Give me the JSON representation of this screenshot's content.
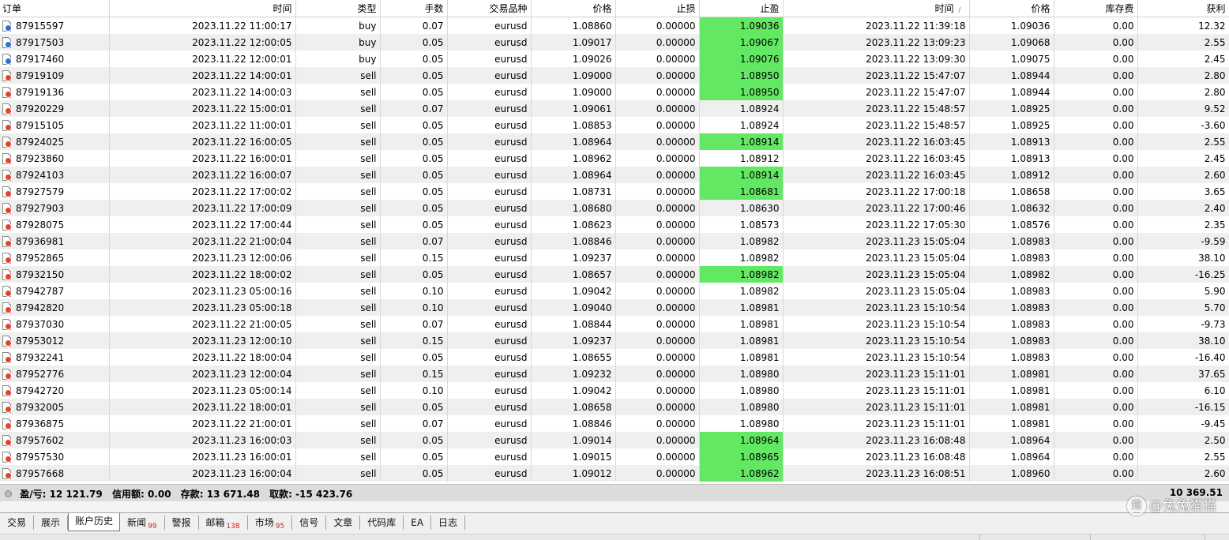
{
  "columns": {
    "order": "订单",
    "open_time": "时间",
    "type": "类型",
    "volume": "手数",
    "symbol": "交易品种",
    "open_price": "价格",
    "sl": "止损",
    "tp": "止盈",
    "close_time": "时间",
    "close_price": "价格",
    "swap": "库存费",
    "profit": "获利"
  },
  "colors": {
    "tp_hit": "#63e863",
    "buy_icon": "#2f6fd8",
    "sell_icon": "#e0452a",
    "row_alt": "#efefef"
  },
  "rows": [
    {
      "order": "87915597",
      "open_time": "2023.11.22 11:00:17",
      "type": "buy",
      "volume": "0.07",
      "symbol": "eurusd",
      "open_price": "1.08860",
      "sl": "0.00000",
      "tp": "1.09036",
      "tp_hit": true,
      "close_time": "2023.11.22 11:39:18",
      "close_price": "1.09036",
      "swap": "0.00",
      "profit": "12.32"
    },
    {
      "order": "87917503",
      "open_time": "2023.11.22 12:00:05",
      "type": "buy",
      "volume": "0.05",
      "symbol": "eurusd",
      "open_price": "1.09017",
      "sl": "0.00000",
      "tp": "1.09067",
      "tp_hit": true,
      "close_time": "2023.11.22 13:09:23",
      "close_price": "1.09068",
      "swap": "0.00",
      "profit": "2.55"
    },
    {
      "order": "87917460",
      "open_time": "2023.11.22 12:00:01",
      "type": "buy",
      "volume": "0.05",
      "symbol": "eurusd",
      "open_price": "1.09026",
      "sl": "0.00000",
      "tp": "1.09076",
      "tp_hit": true,
      "close_time": "2023.11.22 13:09:30",
      "close_price": "1.09075",
      "swap": "0.00",
      "profit": "2.45"
    },
    {
      "order": "87919109",
      "open_time": "2023.11.22 14:00:01",
      "type": "sell",
      "volume": "0.05",
      "symbol": "eurusd",
      "open_price": "1.09000",
      "sl": "0.00000",
      "tp": "1.08950",
      "tp_hit": true,
      "close_time": "2023.11.22 15:47:07",
      "close_price": "1.08944",
      "swap": "0.00",
      "profit": "2.80"
    },
    {
      "order": "87919136",
      "open_time": "2023.11.22 14:00:03",
      "type": "sell",
      "volume": "0.05",
      "symbol": "eurusd",
      "open_price": "1.09000",
      "sl": "0.00000",
      "tp": "1.08950",
      "tp_hit": true,
      "close_time": "2023.11.22 15:47:07",
      "close_price": "1.08944",
      "swap": "0.00",
      "profit": "2.80"
    },
    {
      "order": "87920229",
      "open_time": "2023.11.22 15:00:01",
      "type": "sell",
      "volume": "0.07",
      "symbol": "eurusd",
      "open_price": "1.09061",
      "sl": "0.00000",
      "tp": "1.08924",
      "tp_hit": false,
      "close_time": "2023.11.22 15:48:57",
      "close_price": "1.08925",
      "swap": "0.00",
      "profit": "9.52"
    },
    {
      "order": "87915105",
      "open_time": "2023.11.22 11:00:01",
      "type": "sell",
      "volume": "0.05",
      "symbol": "eurusd",
      "open_price": "1.08853",
      "sl": "0.00000",
      "tp": "1.08924",
      "tp_hit": false,
      "close_time": "2023.11.22 15:48:57",
      "close_price": "1.08925",
      "swap": "0.00",
      "profit": "-3.60"
    },
    {
      "order": "87924025",
      "open_time": "2023.11.22 16:00:05",
      "type": "sell",
      "volume": "0.05",
      "symbol": "eurusd",
      "open_price": "1.08964",
      "sl": "0.00000",
      "tp": "1.08914",
      "tp_hit": true,
      "close_time": "2023.11.22 16:03:45",
      "close_price": "1.08913",
      "swap": "0.00",
      "profit": "2.55"
    },
    {
      "order": "87923860",
      "open_time": "2023.11.22 16:00:01",
      "type": "sell",
      "volume": "0.05",
      "symbol": "eurusd",
      "open_price": "1.08962",
      "sl": "0.00000",
      "tp": "1.08912",
      "tp_hit": false,
      "close_time": "2023.11.22 16:03:45",
      "close_price": "1.08913",
      "swap": "0.00",
      "profit": "2.45"
    },
    {
      "order": "87924103",
      "open_time": "2023.11.22 16:00:07",
      "type": "sell",
      "volume": "0.05",
      "symbol": "eurusd",
      "open_price": "1.08964",
      "sl": "0.00000",
      "tp": "1.08914",
      "tp_hit": true,
      "close_time": "2023.11.22 16:03:45",
      "close_price": "1.08912",
      "swap": "0.00",
      "profit": "2.60"
    },
    {
      "order": "87927579",
      "open_time": "2023.11.22 17:00:02",
      "type": "sell",
      "volume": "0.05",
      "symbol": "eurusd",
      "open_price": "1.08731",
      "sl": "0.00000",
      "tp": "1.08681",
      "tp_hit": true,
      "close_time": "2023.11.22 17:00:18",
      "close_price": "1.08658",
      "swap": "0.00",
      "profit": "3.65"
    },
    {
      "order": "87927903",
      "open_time": "2023.11.22 17:00:09",
      "type": "sell",
      "volume": "0.05",
      "symbol": "eurusd",
      "open_price": "1.08680",
      "sl": "0.00000",
      "tp": "1.08630",
      "tp_hit": false,
      "close_time": "2023.11.22 17:00:46",
      "close_price": "1.08632",
      "swap": "0.00",
      "profit": "2.40"
    },
    {
      "order": "87928075",
      "open_time": "2023.11.22 17:00:44",
      "type": "sell",
      "volume": "0.05",
      "symbol": "eurusd",
      "open_price": "1.08623",
      "sl": "0.00000",
      "tp": "1.08573",
      "tp_hit": false,
      "close_time": "2023.11.22 17:05:30",
      "close_price": "1.08576",
      "swap": "0.00",
      "profit": "2.35"
    },
    {
      "order": "87936981",
      "open_time": "2023.11.22 21:00:04",
      "type": "sell",
      "volume": "0.07",
      "symbol": "eurusd",
      "open_price": "1.08846",
      "sl": "0.00000",
      "tp": "1.08982",
      "tp_hit": false,
      "close_time": "2023.11.23 15:05:04",
      "close_price": "1.08983",
      "swap": "0.00",
      "profit": "-9.59"
    },
    {
      "order": "87952865",
      "open_time": "2023.11.23 12:00:06",
      "type": "sell",
      "volume": "0.15",
      "symbol": "eurusd",
      "open_price": "1.09237",
      "sl": "0.00000",
      "tp": "1.08982",
      "tp_hit": false,
      "close_time": "2023.11.23 15:05:04",
      "close_price": "1.08983",
      "swap": "0.00",
      "profit": "38.10"
    },
    {
      "order": "87932150",
      "open_time": "2023.11.22 18:00:02",
      "type": "sell",
      "volume": "0.05",
      "symbol": "eurusd",
      "open_price": "1.08657",
      "sl": "0.00000",
      "tp": "1.08982",
      "tp_hit": true,
      "close_time": "2023.11.23 15:05:04",
      "close_price": "1.08982",
      "swap": "0.00",
      "profit": "-16.25"
    },
    {
      "order": "87942787",
      "open_time": "2023.11.23 05:00:16",
      "type": "sell",
      "volume": "0.10",
      "symbol": "eurusd",
      "open_price": "1.09042",
      "sl": "0.00000",
      "tp": "1.08982",
      "tp_hit": false,
      "close_time": "2023.11.23 15:05:04",
      "close_price": "1.08983",
      "swap": "0.00",
      "profit": "5.90"
    },
    {
      "order": "87942820",
      "open_time": "2023.11.23 05:00:18",
      "type": "sell",
      "volume": "0.10",
      "symbol": "eurusd",
      "open_price": "1.09040",
      "sl": "0.00000",
      "tp": "1.08981",
      "tp_hit": false,
      "close_time": "2023.11.23 15:10:54",
      "close_price": "1.08983",
      "swap": "0.00",
      "profit": "5.70"
    },
    {
      "order": "87937030",
      "open_time": "2023.11.22 21:00:05",
      "type": "sell",
      "volume": "0.07",
      "symbol": "eurusd",
      "open_price": "1.08844",
      "sl": "0.00000",
      "tp": "1.08981",
      "tp_hit": false,
      "close_time": "2023.11.23 15:10:54",
      "close_price": "1.08983",
      "swap": "0.00",
      "profit": "-9.73"
    },
    {
      "order": "87953012",
      "open_time": "2023.11.23 12:00:10",
      "type": "sell",
      "volume": "0.15",
      "symbol": "eurusd",
      "open_price": "1.09237",
      "sl": "0.00000",
      "tp": "1.08981",
      "tp_hit": false,
      "close_time": "2023.11.23 15:10:54",
      "close_price": "1.08983",
      "swap": "0.00",
      "profit": "38.10"
    },
    {
      "order": "87932241",
      "open_time": "2023.11.22 18:00:04",
      "type": "sell",
      "volume": "0.05",
      "symbol": "eurusd",
      "open_price": "1.08655",
      "sl": "0.00000",
      "tp": "1.08981",
      "tp_hit": false,
      "close_time": "2023.11.23 15:10:54",
      "close_price": "1.08983",
      "swap": "0.00",
      "profit": "-16.40"
    },
    {
      "order": "87952776",
      "open_time": "2023.11.23 12:00:04",
      "type": "sell",
      "volume": "0.15",
      "symbol": "eurusd",
      "open_price": "1.09232",
      "sl": "0.00000",
      "tp": "1.08980",
      "tp_hit": false,
      "close_time": "2023.11.23 15:11:01",
      "close_price": "1.08981",
      "swap": "0.00",
      "profit": "37.65"
    },
    {
      "order": "87942720",
      "open_time": "2023.11.23 05:00:14",
      "type": "sell",
      "volume": "0.10",
      "symbol": "eurusd",
      "open_price": "1.09042",
      "sl": "0.00000",
      "tp": "1.08980",
      "tp_hit": false,
      "close_time": "2023.11.23 15:11:01",
      "close_price": "1.08981",
      "swap": "0.00",
      "profit": "6.10"
    },
    {
      "order": "87932005",
      "open_time": "2023.11.22 18:00:01",
      "type": "sell",
      "volume": "0.05",
      "symbol": "eurusd",
      "open_price": "1.08658",
      "sl": "0.00000",
      "tp": "1.08980",
      "tp_hit": false,
      "close_time": "2023.11.23 15:11:01",
      "close_price": "1.08981",
      "swap": "0.00",
      "profit": "-16.15"
    },
    {
      "order": "87936875",
      "open_time": "2023.11.22 21:00:01",
      "type": "sell",
      "volume": "0.07",
      "symbol": "eurusd",
      "open_price": "1.08846",
      "sl": "0.00000",
      "tp": "1.08980",
      "tp_hit": false,
      "close_time": "2023.11.23 15:11:01",
      "close_price": "1.08981",
      "swap": "0.00",
      "profit": "-9.45"
    },
    {
      "order": "87957602",
      "open_time": "2023.11.23 16:00:03",
      "type": "sell",
      "volume": "0.05",
      "symbol": "eurusd",
      "open_price": "1.09014",
      "sl": "0.00000",
      "tp": "1.08964",
      "tp_hit": true,
      "close_time": "2023.11.23 16:08:48",
      "close_price": "1.08964",
      "swap": "0.00",
      "profit": "2.50"
    },
    {
      "order": "87957530",
      "open_time": "2023.11.23 16:00:01",
      "type": "sell",
      "volume": "0.05",
      "symbol": "eurusd",
      "open_price": "1.09015",
      "sl": "0.00000",
      "tp": "1.08965",
      "tp_hit": true,
      "close_time": "2023.11.23 16:08:48",
      "close_price": "1.08964",
      "swap": "0.00",
      "profit": "2.55"
    },
    {
      "order": "87957668",
      "open_time": "2023.11.23 16:00:04",
      "type": "sell",
      "volume": "0.05",
      "symbol": "eurusd",
      "open_price": "1.09012",
      "sl": "0.00000",
      "tp": "1.08962",
      "tp_hit": true,
      "close_time": "2023.11.23 16:08:51",
      "close_price": "1.08960",
      "swap": "0.00",
      "profit": "2.60"
    }
  ],
  "summary": {
    "profit_label": "盈/亏:",
    "profit_value": "12 121.79",
    "credit_label": "信用额:",
    "credit_value": "0.00",
    "deposit_label": "存款:",
    "deposit_value": "13 671.48",
    "withdrawal_label": "取款:",
    "withdrawal_value": "-15 423.76",
    "total": "10 369.51"
  },
  "tabs": [
    {
      "label": "交易",
      "badge": ""
    },
    {
      "label": "展示",
      "badge": ""
    },
    {
      "label": "账户历史",
      "badge": "",
      "active": true
    },
    {
      "label": "新闻",
      "badge": "99"
    },
    {
      "label": "警报",
      "badge": ""
    },
    {
      "label": "邮箱",
      "badge": "138"
    },
    {
      "label": "市场",
      "badge": "95"
    },
    {
      "label": "信号",
      "badge": ""
    },
    {
      "label": "文章",
      "badge": ""
    },
    {
      "label": "代码库",
      "badge": ""
    },
    {
      "label": "EA",
      "badge": ""
    },
    {
      "label": "日志",
      "badge": ""
    }
  ],
  "watermark": {
    "logo_char": "知",
    "text": "@兔兔猫猫"
  }
}
